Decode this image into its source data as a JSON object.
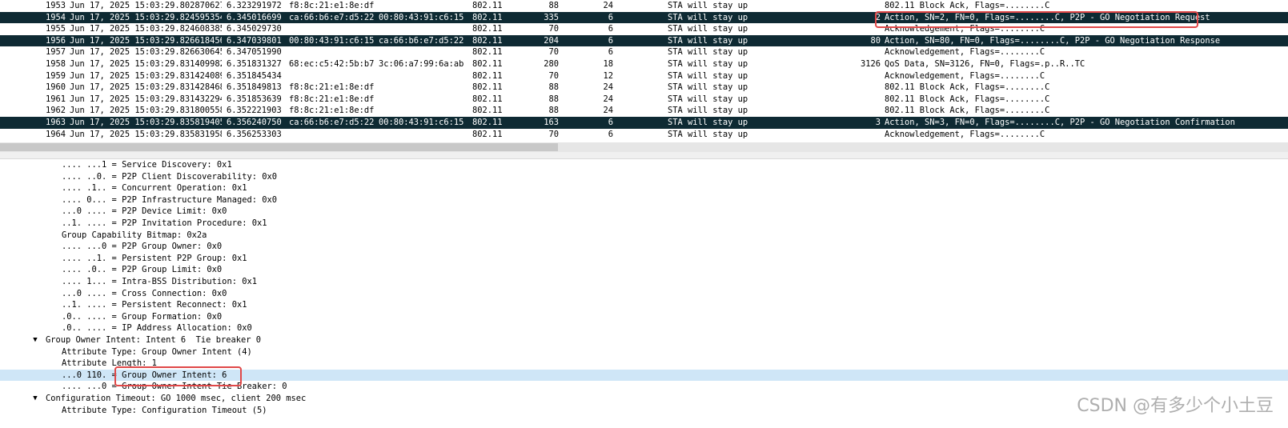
{
  "packets": [
    {
      "no": "1953",
      "time": "Jun 17, 2025 15:03:29.802870627…",
      "rel": "6.323291972",
      "src": "f8:8c:21:e1:8e:df",
      "dst": "",
      "proto": "802.11",
      "len": "88",
      "x": "24",
      "status": "STA will stay up",
      "sn": "",
      "info": "802.11 Block Ack, Flags=........C",
      "selected": false
    },
    {
      "no": "1954",
      "time": "Jun 17, 2025 15:03:29.824595354…",
      "rel": "6.345016699",
      "src": "ca:66:b6:e7:d5:22",
      "dst": "00:80:43:91:c6:15",
      "proto": "802.11",
      "len": "335",
      "x": "6",
      "status": "STA will stay up",
      "sn": "2",
      "info": "Action, SN=2, FN=0, Flags=........C, P2P - GO Negotiation Request",
      "selected": true
    },
    {
      "no": "1955",
      "time": "Jun 17, 2025 15:03:29.824608385…",
      "rel": "6.345029730",
      "src": "",
      "dst": "",
      "proto": "802.11",
      "len": "70",
      "x": "6",
      "status": "STA will stay up",
      "sn": "",
      "info": "Acknowledgement, Flags=........C",
      "selected": false
    },
    {
      "no": "1956",
      "time": "Jun 17, 2025 15:03:29.826618456…",
      "rel": "6.347039801",
      "src": "00:80:43:91:c6:15",
      "dst": "ca:66:b6:e7:d5:22",
      "proto": "802.11",
      "len": "204",
      "x": "6",
      "status": "STA will stay up",
      "sn": "80",
      "info": "Action, SN=80, FN=0, Flags=........C, P2P - GO Negotiation Response",
      "selected": true
    },
    {
      "no": "1957",
      "time": "Jun 17, 2025 15:03:29.826630645…",
      "rel": "6.347051990",
      "src": "",
      "dst": "",
      "proto": "802.11",
      "len": "70",
      "x": "6",
      "status": "STA will stay up",
      "sn": "",
      "info": "Acknowledgement, Flags=........C",
      "selected": false
    },
    {
      "no": "1958",
      "time": "Jun 17, 2025 15:03:29.831409982…",
      "rel": "6.351831327",
      "src": "68:ec:c5:42:5b:b7",
      "dst": "3c:06:a7:99:6a:ab",
      "proto": "802.11",
      "len": "280",
      "x": "18",
      "status": "STA will stay up",
      "sn": "3126",
      "info": "QoS Data, SN=3126, FN=0, Flags=.p..R..TC",
      "selected": false
    },
    {
      "no": "1959",
      "time": "Jun 17, 2025 15:03:29.831424089…",
      "rel": "6.351845434",
      "src": "",
      "dst": "",
      "proto": "802.11",
      "len": "70",
      "x": "12",
      "status": "STA will stay up",
      "sn": "",
      "info": "Acknowledgement, Flags=........C",
      "selected": false
    },
    {
      "no": "1960",
      "time": "Jun 17, 2025 15:03:29.831428468…",
      "rel": "6.351849813",
      "src": "f8:8c:21:e1:8e:df",
      "dst": "",
      "proto": "802.11",
      "len": "88",
      "x": "24",
      "status": "STA will stay up",
      "sn": "",
      "info": "802.11 Block Ack, Flags=........C",
      "selected": false
    },
    {
      "no": "1961",
      "time": "Jun 17, 2025 15:03:29.831432294…",
      "rel": "6.351853639",
      "src": "f8:8c:21:e1:8e:df",
      "dst": "",
      "proto": "802.11",
      "len": "88",
      "x": "24",
      "status": "STA will stay up",
      "sn": "",
      "info": "802.11 Block Ack, Flags=........C",
      "selected": false
    },
    {
      "no": "1962",
      "time": "Jun 17, 2025 15:03:29.831800558…",
      "rel": "6.352221903",
      "src": "f8:8c:21:e1:8e:df",
      "dst": "",
      "proto": "802.11",
      "len": "88",
      "x": "24",
      "status": "STA will stay up",
      "sn": "",
      "info": "802.11 Block Ack, Flags=........C",
      "selected": false
    },
    {
      "no": "1963",
      "time": "Jun 17, 2025 15:03:29.835819405…",
      "rel": "6.356240750",
      "src": "ca:66:b6:e7:d5:22",
      "dst": "00:80:43:91:c6:15",
      "proto": "802.11",
      "len": "163",
      "x": "6",
      "status": "STA will stay up",
      "sn": "3",
      "info": "Action, SN=3, FN=0, Flags=........C, P2P - GO Negotiation Confirmation",
      "selected": true
    },
    {
      "no": "1964",
      "time": "Jun 17, 2025 15:03:29.835831958…",
      "rel": "6.356253303",
      "src": "",
      "dst": "",
      "proto": "802.11",
      "len": "70",
      "x": "6",
      "status": "STA will stay up",
      "sn": "",
      "info": "Acknowledgement, Flags=........C",
      "selected": false
    }
  ],
  "details": [
    {
      "indent": 2,
      "text": ".... ...1 = Service Discovery: 0x1"
    },
    {
      "indent": 2,
      "text": ".... ..0. = P2P Client Discoverability: 0x0"
    },
    {
      "indent": 2,
      "text": ".... .1.. = Concurrent Operation: 0x1"
    },
    {
      "indent": 2,
      "text": ".... 0... = P2P Infrastructure Managed: 0x0"
    },
    {
      "indent": 2,
      "text": "...0 .... = P2P Device Limit: 0x0"
    },
    {
      "indent": 2,
      "text": "..1. .... = P2P Invitation Procedure: 0x1"
    },
    {
      "indent": 1,
      "text": "Group Capability Bitmap: 0x2a"
    },
    {
      "indent": 2,
      "text": ".... ...0 = P2P Group Owner: 0x0"
    },
    {
      "indent": 2,
      "text": ".... ..1. = Persistent P2P Group: 0x1"
    },
    {
      "indent": 2,
      "text": ".... .0.. = P2P Group Limit: 0x0"
    },
    {
      "indent": 2,
      "text": ".... 1... = Intra-BSS Distribution: 0x1"
    },
    {
      "indent": 2,
      "text": "...0 .... = Cross Connection: 0x0"
    },
    {
      "indent": 2,
      "text": "..1. .... = Persistent Reconnect: 0x1"
    },
    {
      "indent": 2,
      "text": ".0.. .... = Group Formation: 0x0"
    },
    {
      "indent": 2,
      "text": ".0.. .... = IP Address Allocation: 0x0"
    },
    {
      "indent": 0,
      "text": "Group Owner Intent: Intent 6  Tie breaker 0",
      "expanded": true
    },
    {
      "indent": 1,
      "text": "Attribute Type: Group Owner Intent (4)"
    },
    {
      "indent": 1,
      "text": "Attribute Length: 1"
    },
    {
      "indent": 1,
      "text": "...0 110. = Group Owner Intent: 6",
      "highlighted": true
    },
    {
      "indent": 1,
      "text": ".... ...0 = Group Owner Intent Tie Breaker: 0"
    },
    {
      "indent": 0,
      "text": "Configuration Timeout: GO 1000 msec, client 200 msec",
      "expanded": true
    },
    {
      "indent": 1,
      "text": "Attribute Type: Configuration Timeout (5)"
    }
  ],
  "watermark": "CSDN @有多少个小土豆",
  "colors": {
    "selected_row": "#0e2a33",
    "highlight_row": "#cfe6f7",
    "annotation_box": "#e04848"
  }
}
